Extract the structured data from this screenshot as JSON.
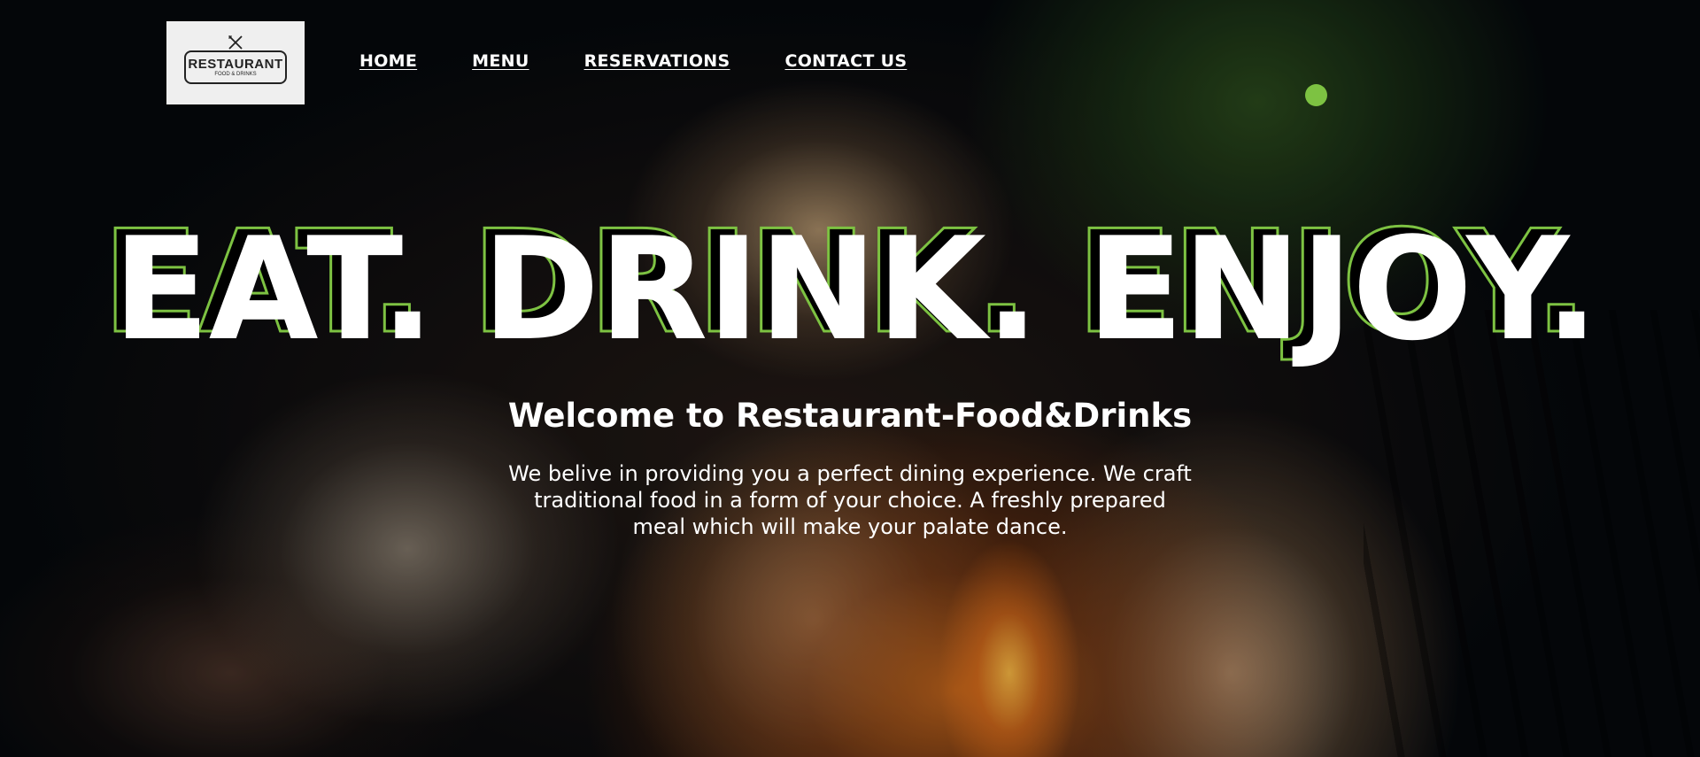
{
  "logo": {
    "name": "RESTAURANT",
    "subtitle": "FOOD & DRINKS"
  },
  "nav": {
    "items": [
      {
        "label": "HOME"
      },
      {
        "label": "MENU"
      },
      {
        "label": "RESERVATIONS"
      },
      {
        "label": "CONTACT US"
      }
    ]
  },
  "hero": {
    "headline": "EAT. DRINK. ENJOY.",
    "welcome": "Welcome to Restaurant-Food&Drinks",
    "intro": "We belive in providing you a perfect dining experience. We craft traditional food in a form of your choice. A freshly prepared meal which will make your palate dance."
  },
  "colors": {
    "accent": "#7dc242",
    "logo_bg": "#efefef",
    "text": "#ffffff"
  },
  "icons": {
    "logo_utensils": "crossed-fork-knife-icon",
    "indicator": "green-dot"
  }
}
